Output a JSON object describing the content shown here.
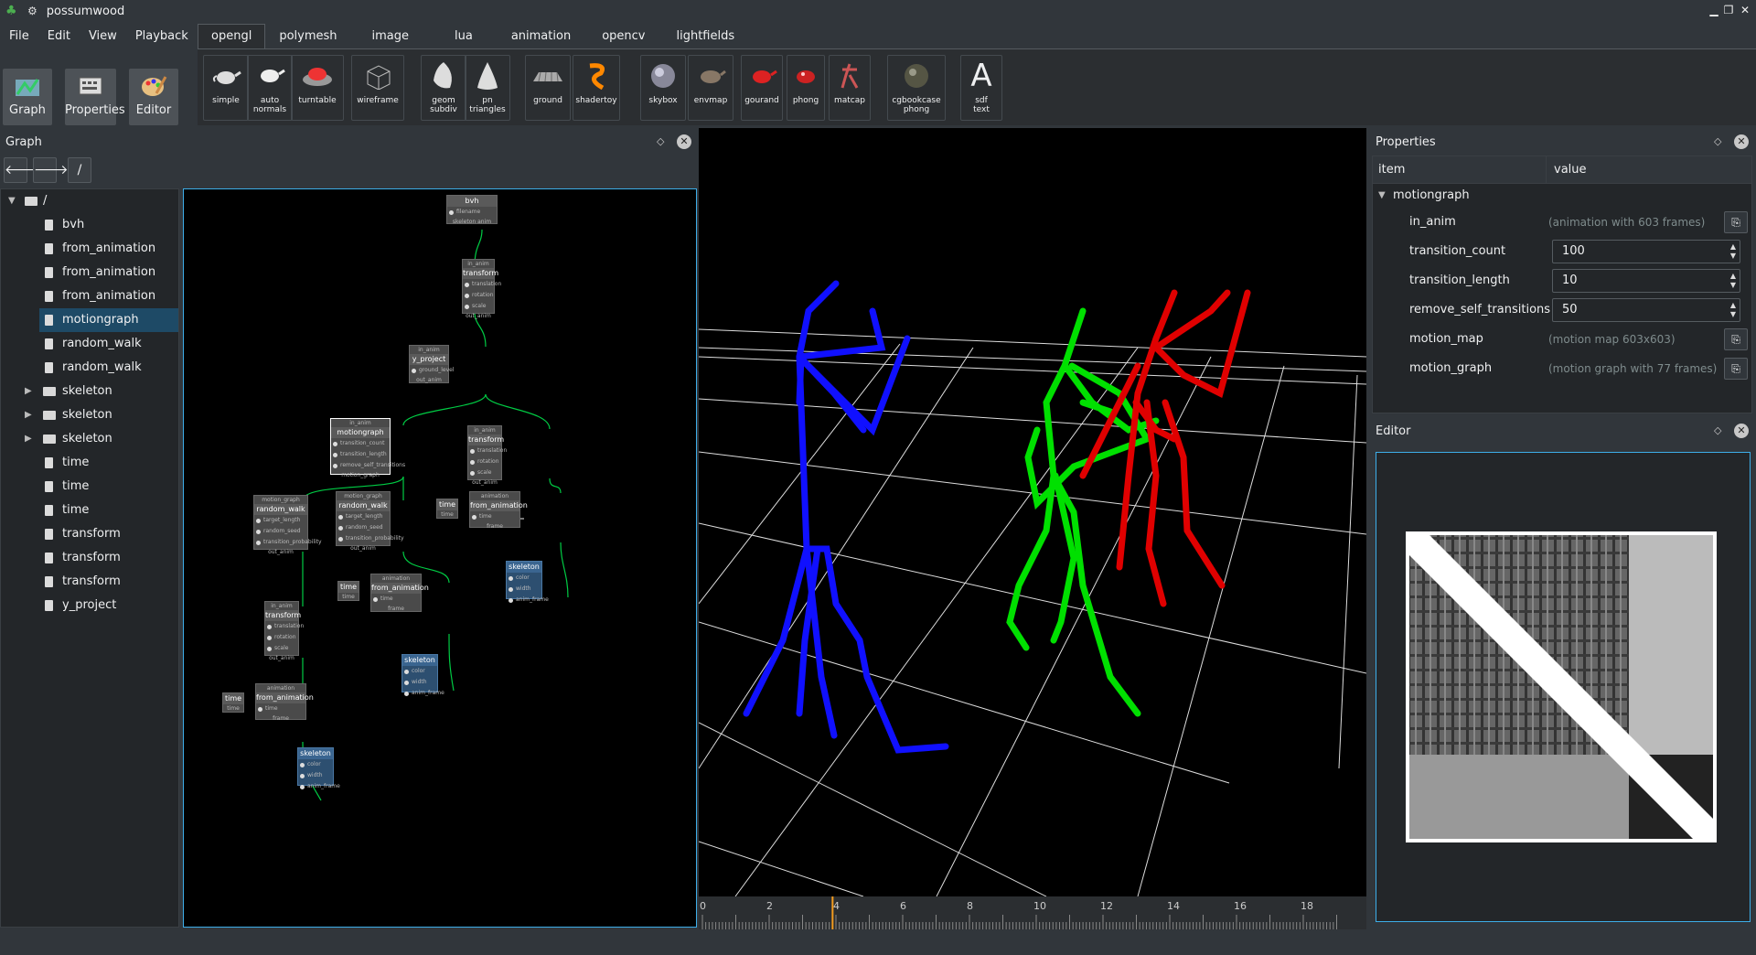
{
  "window": {
    "title": "possumwood",
    "minimize": "▁",
    "restore": "❐",
    "close": "✕"
  },
  "menu": [
    "File",
    "Edit",
    "View",
    "Playback"
  ],
  "modes": [
    {
      "label": "Graph"
    },
    {
      "label": "Properties"
    },
    {
      "label": "Editor"
    }
  ],
  "tabs": [
    {
      "label": "opengl",
      "active": true
    },
    {
      "label": "polymesh"
    },
    {
      "label": "image"
    },
    {
      "label": "lua"
    },
    {
      "label": "animation"
    },
    {
      "label": "opencv"
    },
    {
      "label": "lightfields"
    }
  ],
  "tools": [
    {
      "label": "simple",
      "icon": "teapot-icon"
    },
    {
      "label": "auto\nnormals",
      "icon": "teapot-icon"
    },
    {
      "label": "turntable",
      "icon": "turntable-icon"
    },
    {
      "label": "wireframe",
      "icon": "wireframe-cube-icon"
    },
    {
      "label": "geom\nsubdiv",
      "icon": "subdiv-icon"
    },
    {
      "label": "pn\ntriangles",
      "icon": "cone-icon"
    },
    {
      "label": "ground",
      "icon": "ground-icon"
    },
    {
      "label": "shadertoy",
      "icon": "shadertoy-icon"
    },
    {
      "label": "skybox",
      "icon": "skybox-icon"
    },
    {
      "label": "envmap",
      "icon": "envmap-icon"
    },
    {
      "label": "gourand",
      "icon": "red-teapot-icon"
    },
    {
      "label": "phong",
      "icon": "red-teapot-icon"
    },
    {
      "label": "matcap",
      "icon": "matcap-icon"
    },
    {
      "label": "cgbookcase\nphong",
      "icon": "sphere-icon"
    },
    {
      "label": "sdf\ntext",
      "icon": "letter-a-icon",
      "glyph": "A"
    }
  ],
  "graph_panel": {
    "title": "Graph",
    "back": "🡐",
    "forward": "🡒",
    "path": "/",
    "tree": [
      {
        "label": "/",
        "kind": "root"
      },
      {
        "label": "bvh",
        "kind": "file"
      },
      {
        "label": "from_animation",
        "kind": "file"
      },
      {
        "label": "from_animation",
        "kind": "file"
      },
      {
        "label": "from_animation",
        "kind": "file"
      },
      {
        "label": "motiongraph",
        "kind": "file",
        "selected": true
      },
      {
        "label": "random_walk",
        "kind": "file"
      },
      {
        "label": "random_walk",
        "kind": "file"
      },
      {
        "label": "skeleton",
        "kind": "folder"
      },
      {
        "label": "skeleton",
        "kind": "folder"
      },
      {
        "label": "skeleton",
        "kind": "folder"
      },
      {
        "label": "time",
        "kind": "file"
      },
      {
        "label": "time",
        "kind": "file"
      },
      {
        "label": "time",
        "kind": "file"
      },
      {
        "label": "transform",
        "kind": "file"
      },
      {
        "label": "transform",
        "kind": "file"
      },
      {
        "label": "transform",
        "kind": "file"
      },
      {
        "label": "y_project",
        "kind": "file"
      }
    ]
  },
  "nodes": {
    "bvh": {
      "title": "bvh",
      "ports": [
        "filename"
      ],
      "outs": "skeleton      anim"
    },
    "transform1": {
      "hdr": "in_anim",
      "title": "transform",
      "ports": [
        "translation",
        "rotation",
        "scale"
      ],
      "out": "out_anim"
    },
    "yproject": {
      "hdr": "in_anim",
      "title": "y_project",
      "ports": [
        "ground_level"
      ],
      "out": "out_anim"
    },
    "motiongraph": {
      "hdr": "in_anim",
      "title": "motiongraph",
      "ports": [
        "transition_count",
        "transition_length",
        "remove_self_transitions"
      ],
      "out": "motion_graph"
    },
    "transform2": {
      "hdr": "in_anim",
      "title": "transform",
      "ports": [
        "translation",
        "rotation",
        "scale"
      ],
      "out": "out_anim"
    },
    "randomwalk1": {
      "hdr": "motion_graph",
      "title": "random_walk",
      "ports": [
        "target_length",
        "random_seed",
        "transition_probability"
      ],
      "out": "out_anim"
    },
    "randomwalk2": {
      "hdr": "motion_graph",
      "title": "random_walk",
      "ports": [
        "target_length",
        "random_seed",
        "transition_probability"
      ],
      "out": "out_anim"
    },
    "fromanim1": {
      "hdr": "animation",
      "title": "from_animation",
      "ports": [
        "time"
      ],
      "out": "frame"
    },
    "fromanim2": {
      "hdr": "animation",
      "title": "from_animation",
      "ports": [
        "time"
      ],
      "out": "frame"
    },
    "fromanim3": {
      "hdr": "animation",
      "title": "from_animation",
      "ports": [
        "time"
      ],
      "out": "frame"
    },
    "transform3": {
      "hdr": "in_anim",
      "title": "transform",
      "ports": [
        "translation",
        "rotation",
        "scale"
      ],
      "out": "out_anim"
    },
    "time": {
      "title": "time",
      "port": "time"
    },
    "skeleton": {
      "title": "skeleton",
      "ports": [
        "color",
        "width",
        "anim_frame"
      ]
    }
  },
  "timeline": {
    "ticks": [
      "0",
      "2",
      "4",
      "6",
      "8",
      "10",
      "12",
      "14",
      "16",
      "18"
    ],
    "current_frame": 3.9
  },
  "properties_panel": {
    "title": "Properties",
    "col_item": "item",
    "col_value": "value",
    "group": "motiongraph",
    "rows": [
      {
        "key": "in_anim",
        "value": "(animation with 603 frames)",
        "type": "readonly"
      },
      {
        "key": "transition_count",
        "value": "100",
        "type": "spin"
      },
      {
        "key": "transition_length",
        "value": "10",
        "type": "spin"
      },
      {
        "key": "remove_self_transitions",
        "value": "50",
        "type": "spin"
      },
      {
        "key": "motion_map",
        "value": "(motion map 603x603)",
        "type": "readonly"
      },
      {
        "key": "motion_graph",
        "value": "(motion graph with 77 frames)",
        "type": "readonly"
      }
    ]
  },
  "editor_panel": {
    "title": "Editor"
  },
  "colors": {
    "accent": "#3daee9",
    "selected": "#1e4a66",
    "blue_fig": "#1010ff",
    "green_fig": "#00e000",
    "red_fig": "#e00000",
    "link": "#00cc44"
  }
}
